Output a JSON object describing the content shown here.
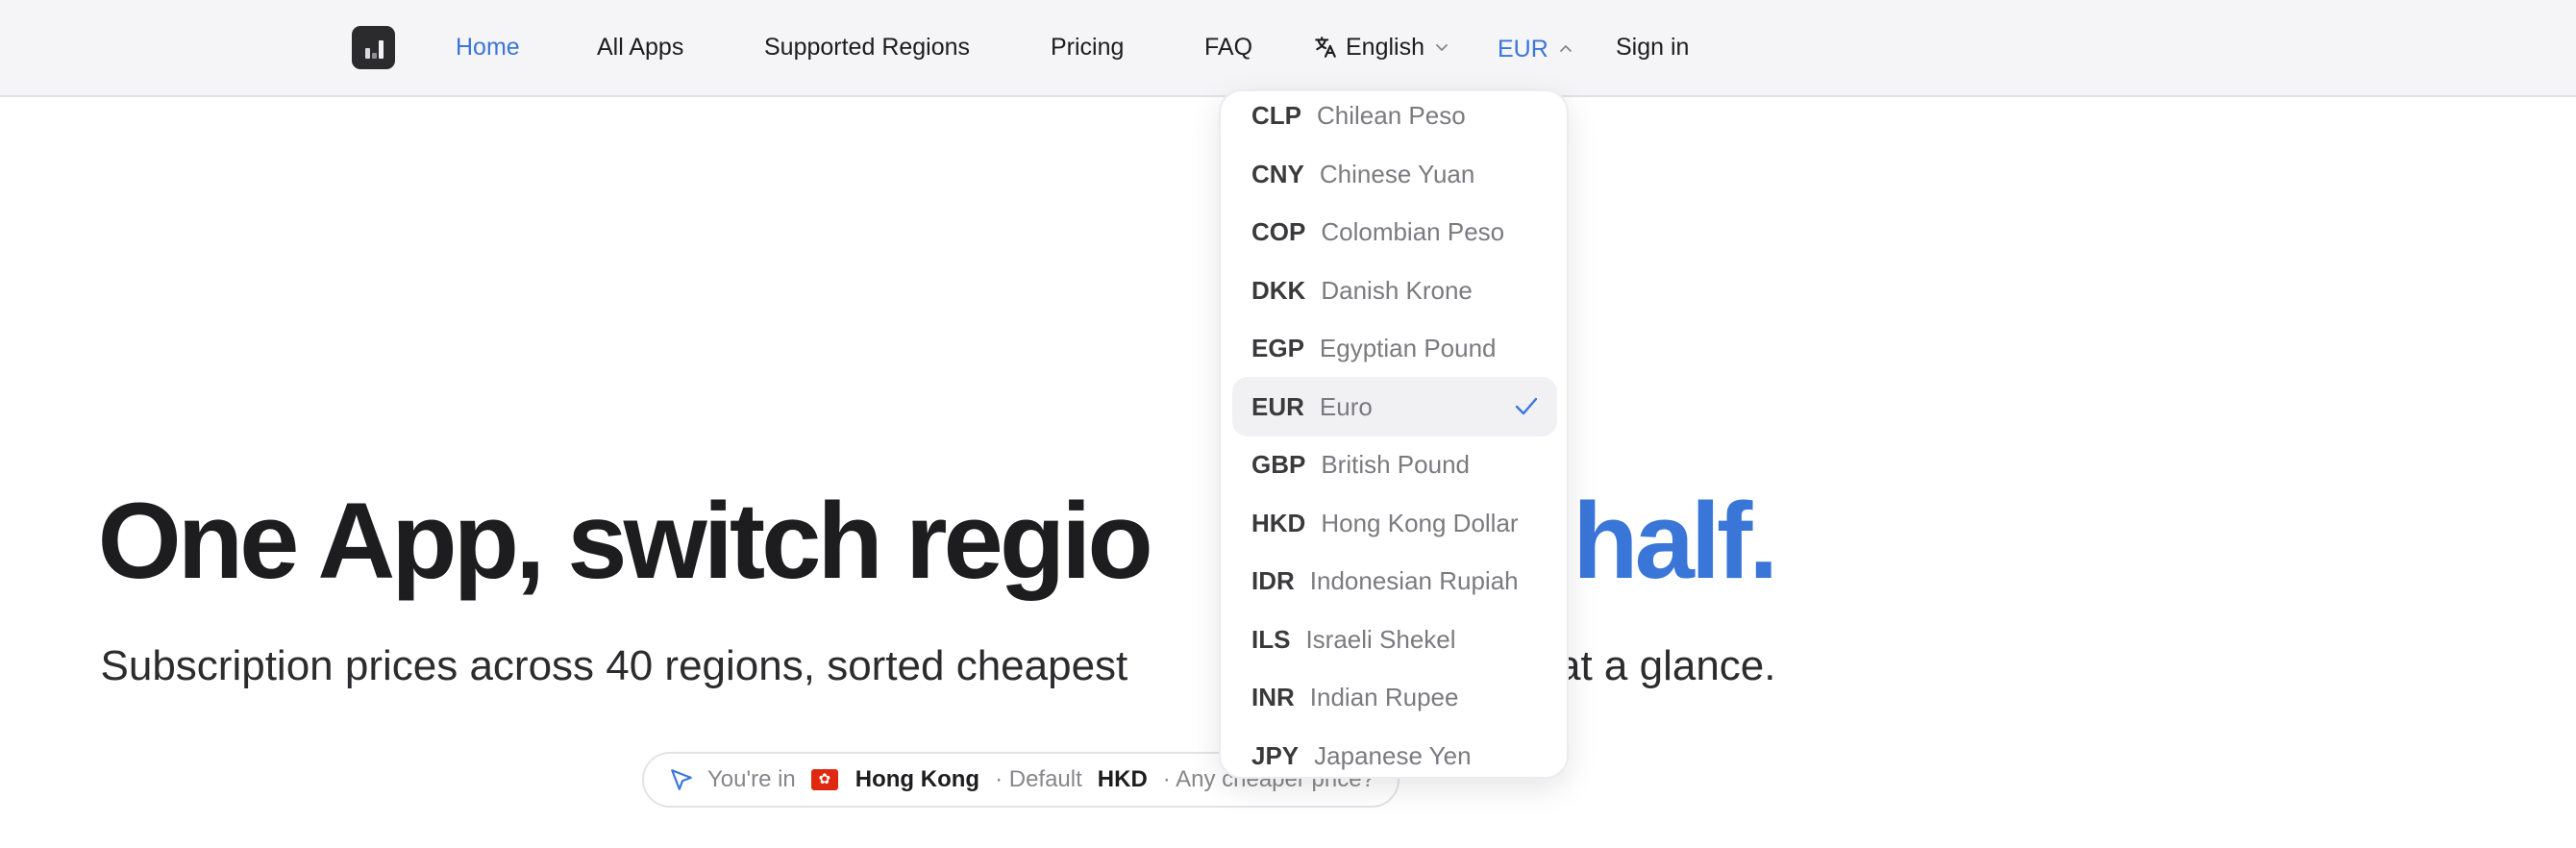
{
  "nav": {
    "items": [
      {
        "label": "Home"
      },
      {
        "label": "All Apps"
      },
      {
        "label": "Supported Regions"
      },
      {
        "label": "Pricing"
      },
      {
        "label": "FAQ"
      }
    ],
    "language": "English",
    "currency": "EUR",
    "signin": "Sign in"
  },
  "hero": {
    "title_part1": "One App, switch regio",
    "title_accent": "e half.",
    "subtitle": "Subscription prices across 40 regions, sorted cheapest",
    "subtitle_end": "west at a glance."
  },
  "location": {
    "prefix": "You're in",
    "region": "Hong Kong",
    "default_label": "· Default",
    "default_currency": "HKD",
    "suffix": "· Any cheaper price?"
  },
  "currency_dropdown": {
    "items": [
      {
        "code": "CLP",
        "name": "Chilean Peso"
      },
      {
        "code": "CNY",
        "name": "Chinese Yuan"
      },
      {
        "code": "COP",
        "name": "Colombian Peso"
      },
      {
        "code": "DKK",
        "name": "Danish Krone"
      },
      {
        "code": "EGP",
        "name": "Egyptian Pound"
      },
      {
        "code": "EUR",
        "name": "Euro"
      },
      {
        "code": "GBP",
        "name": "British Pound"
      },
      {
        "code": "HKD",
        "name": "Hong Kong Dollar"
      },
      {
        "code": "IDR",
        "name": "Indonesian Rupiah"
      },
      {
        "code": "ILS",
        "name": "Israeli Shekel"
      },
      {
        "code": "INR",
        "name": "Indian Rupee"
      },
      {
        "code": "JPY",
        "name": "Japanese Yen"
      }
    ],
    "selected_code": "EUR"
  },
  "colors": {
    "accent": "#3a76d8",
    "nav_bg": "#f5f5f7",
    "text": "#1d1d1f",
    "muted": "#86868b"
  },
  "icons": {
    "logo": "bar-chart-logo-icon",
    "language": "translate-icon",
    "location": "location-arrow-icon",
    "flag": "hong-kong-flag-icon",
    "check": "checkmark-icon"
  }
}
